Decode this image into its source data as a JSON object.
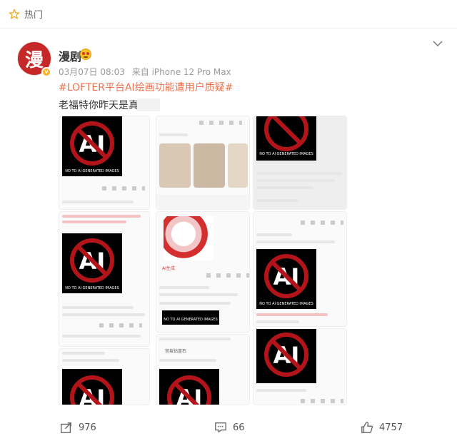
{
  "topbar": {
    "label": "热门",
    "icon": "star-icon"
  },
  "author": {
    "avatar_glyph": "漫",
    "avatar_color": "#c62828",
    "name": "漫剧",
    "verified_icon": "verified-badge-icon"
  },
  "meta": {
    "time": "03月07日 08:03",
    "source": "来自 iPhone 12 Pro Max"
  },
  "post": {
    "hashtag": "#LOFTER平台AI绘画功能遭用户质疑#",
    "text": "老福特你昨天是真"
  },
  "images": {
    "badge_text": "NO TO AI GENERATED IMAGES",
    "badge_glyph": "AI",
    "shots": [
      "screenshot-1",
      "screenshot-2",
      "screenshot-3",
      "screenshot-4",
      "screenshot-5",
      "screenshot-6",
      "screenshot-7",
      "screenshot-8",
      "screenshot-9"
    ],
    "img5_caption": "AI生成",
    "img8_user": "宫坂钻蓝石"
  },
  "footer": {
    "repost_count": "976",
    "comment_count": "66",
    "like_count": "4757"
  },
  "colors": {
    "hashtag": "#eb7350",
    "accent": "#ff8200"
  }
}
